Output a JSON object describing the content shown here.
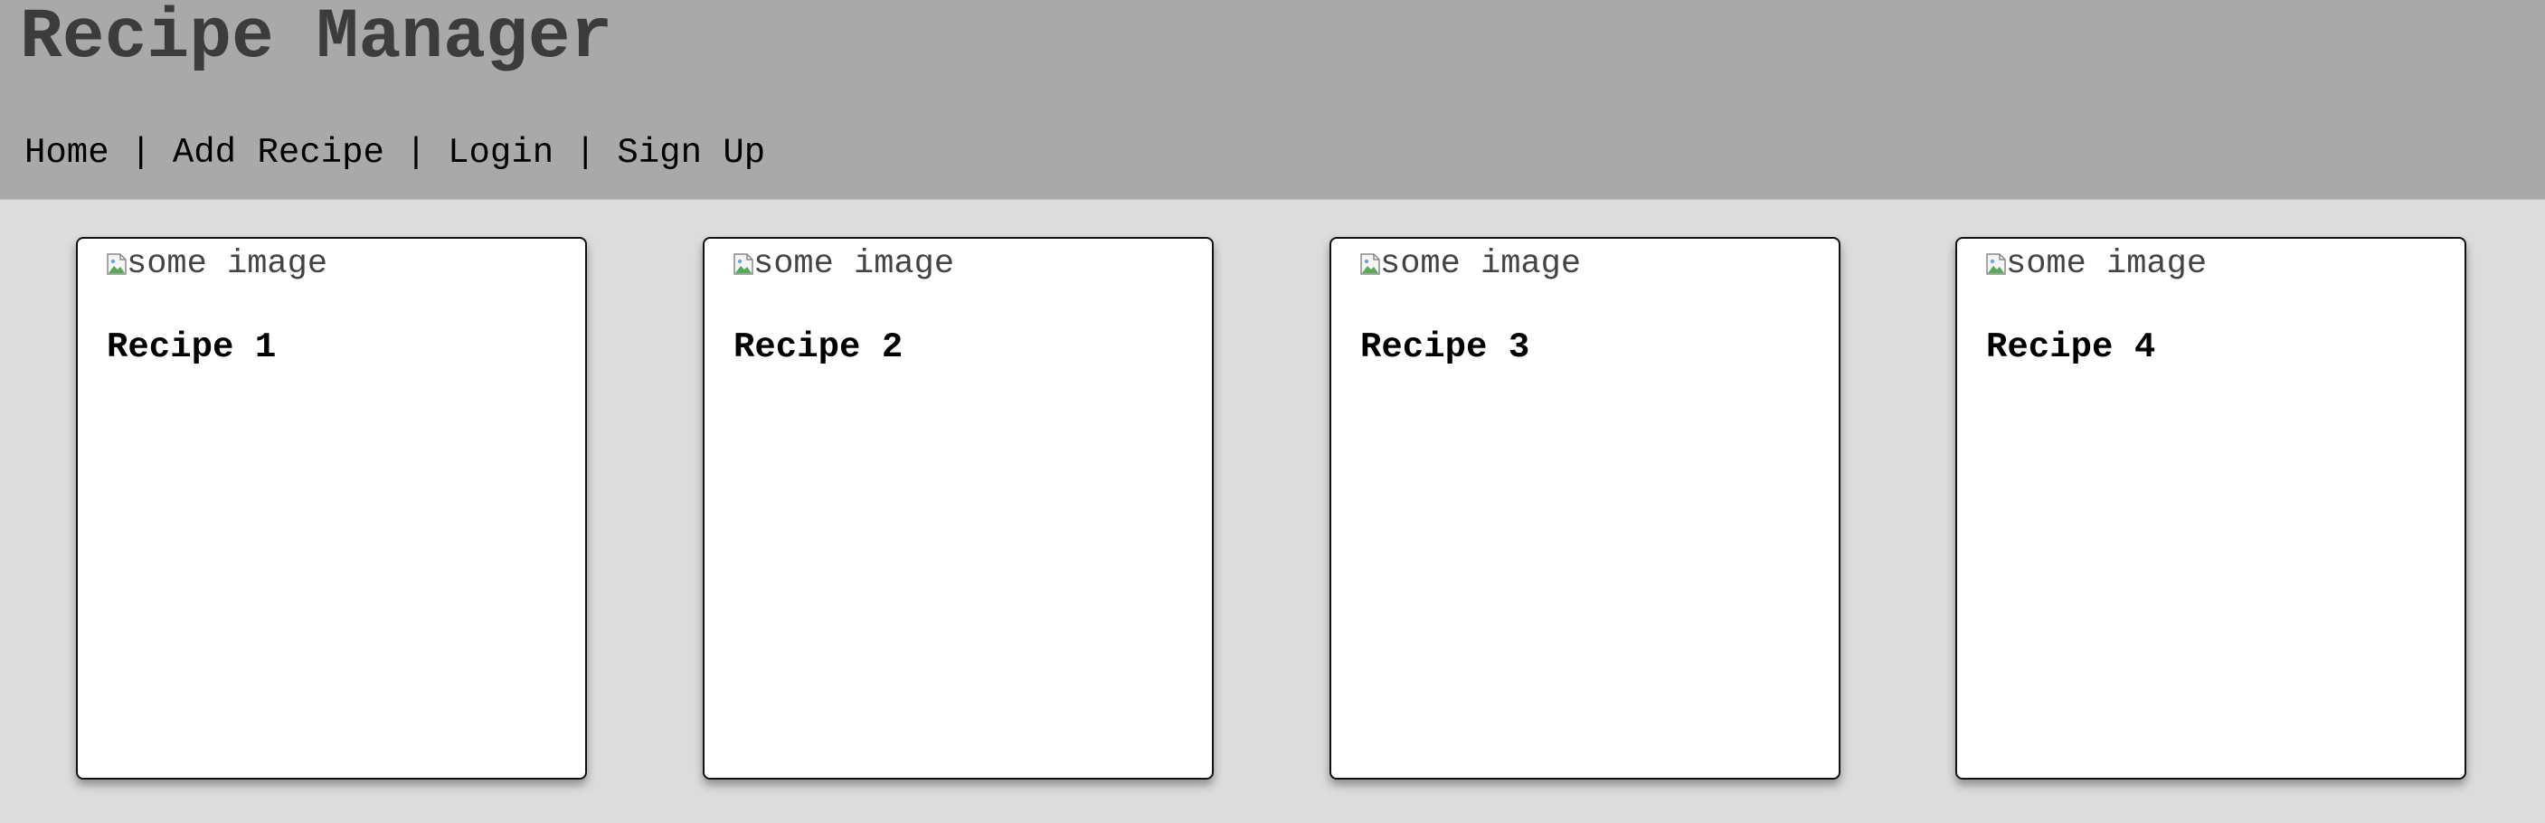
{
  "header": {
    "title": "Recipe Manager",
    "nav": [
      {
        "label": "Home"
      },
      {
        "label": "Add Recipe"
      },
      {
        "label": "Login"
      },
      {
        "label": "Sign Up"
      }
    ],
    "separator": "|"
  },
  "recipes": [
    {
      "title": "Recipe 1",
      "image_alt": "some image"
    },
    {
      "title": "Recipe 2",
      "image_alt": "some image"
    },
    {
      "title": "Recipe 3",
      "image_alt": "some image"
    },
    {
      "title": "Recipe 4",
      "image_alt": "some image"
    }
  ],
  "colors": {
    "header_bg": "#a9a9a9",
    "page_bg": "#dcdcdc",
    "title_color": "#3c3c3c"
  },
  "icons": {
    "broken_image": "broken-image-icon"
  }
}
